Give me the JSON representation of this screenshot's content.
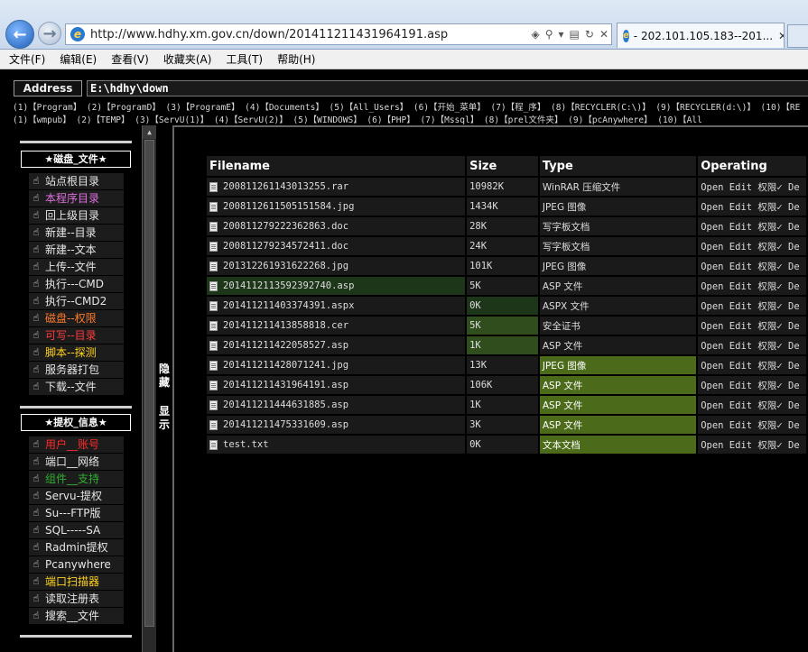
{
  "browser": {
    "url": "http://www.hdhy.xm.gov.cn/down/201411211431964191.asp",
    "tab_title": "- 202.101.105.183--201...",
    "menu": [
      "文件(F)",
      "编辑(E)",
      "查看(V)",
      "收藏夹(A)",
      "工具(T)",
      "帮助(H)"
    ]
  },
  "address": {
    "label": "Address",
    "path": "E:\\hdhy\\down"
  },
  "quick_links": {
    "row1": "(1)【Program】 (2)【ProgramD】 (3)【ProgramE】 (4)【Documents】 (5)【All_Users】 (6)【开始_菜单】 (7)【程_序】 (8)【RECYCLER(C:\\)】 (9)【RECYCLER(d:\\)】 (10)【RE",
    "row2": "(1)【wmpub】 (2)【TEMP】 (3)【ServU(1)】 (4)【ServU(2)】 (5)【WINDOWS】 (6)【PHP】 (7)【Mssql】 (8)【prel文件夹】 (9)【pcAnywhere】 (10)【All"
  },
  "sidebar": {
    "section1_title": "★磁盘_文件★",
    "section1_items": [
      {
        "label": "站点根目录",
        "color": "#e6e6e6"
      },
      {
        "label": "本程序目录",
        "color": "#e070e0"
      },
      {
        "label": "回上级目录",
        "color": "#e6e6e6"
      },
      {
        "label": "新建--目录",
        "color": "#e6e6e6"
      },
      {
        "label": "新建--文本",
        "color": "#e6e6e6"
      },
      {
        "label": "上传--文件",
        "color": "#e6e6e6"
      },
      {
        "label": "执行---CMD",
        "color": "#e6e6e6"
      },
      {
        "label": "执行--CMD2",
        "color": "#e6e6e6"
      },
      {
        "label": "磁盘--权限",
        "color": "#ff7a2a"
      },
      {
        "label": "可写--目录",
        "color": "#ff3c3c"
      },
      {
        "label": "脚本--探测",
        "color": "#ffd21e"
      },
      {
        "label": "服务器打包",
        "color": "#e6e6e6"
      },
      {
        "label": "下载--文件",
        "color": "#e6e6e6"
      }
    ],
    "section2_title": "★提权_信息★",
    "section2_items": [
      {
        "label": "用户__账号",
        "color": "#ff2a2a"
      },
      {
        "label": "端口__网络",
        "color": "#e6e6e6"
      },
      {
        "label": "组件__支持",
        "color": "#2fae2f"
      },
      {
        "label": "Servu-提权",
        "color": "#e6e6e6"
      },
      {
        "label": "Su---FTP版",
        "color": "#e6e6e6"
      },
      {
        "label": "SQL-----SA",
        "color": "#e6e6e6"
      },
      {
        "label": "Radmin提权",
        "color": "#e6e6e6"
      },
      {
        "label": "Pcanywhere",
        "color": "#e6e6e6"
      },
      {
        "label": "端口扫描器",
        "color": "#ffd21e"
      },
      {
        "label": "读取注册表",
        "color": "#e6e6e6"
      },
      {
        "label": "搜索__文件",
        "color": "#e6e6e6"
      }
    ]
  },
  "toggle": {
    "hide": "隐藏",
    "show": "显示"
  },
  "table": {
    "headers": {
      "name": "Filename",
      "size": "Size",
      "type": "Type",
      "ops": "Operating"
    },
    "ops_text": "Open Edit 权限✓ De",
    "rows": [
      {
        "name": "20081126114301325 5.rar",
        "size": "10982K",
        "type": "WinRAR 压缩文件",
        "hl": ""
      },
      {
        "name": "200811261150515158 4.jpg",
        "size": "1434K",
        "type": "JPEG 图像",
        "hl": ""
      },
      {
        "name": "200811279222362863.doc",
        "size": "28K",
        "type": "写字板文档",
        "hl": ""
      },
      {
        "name": "200811279234572411.doc",
        "size": "24K",
        "type": "写字板文档",
        "hl": ""
      },
      {
        "name": "20131226193162226 8.jpg",
        "size": "101K",
        "type": "JPEG 图像",
        "hl": ""
      },
      {
        "name": "201411211359239274 0.asp",
        "size": "5K",
        "type": "ASP 文件",
        "hl": "name"
      },
      {
        "name": "201411211403374391.aspx",
        "size": "0K",
        "type": "ASPX 文件",
        "hl": "size"
      },
      {
        "name": "201411211413858818.cer",
        "size": "5K",
        "type": "安全证书",
        "hl": "size2"
      },
      {
        "name": "201411211422058527.asp",
        "size": "1K",
        "type": "ASP 文件",
        "hl": "size3"
      },
      {
        "name": "201411211428071241.jpg",
        "size": "13K",
        "type": "JPEG 图像",
        "hl": "type"
      },
      {
        "name": "201411211431964191.asp",
        "size": "106K",
        "type": "ASP 文件",
        "hl": "type"
      },
      {
        "name": "201411211444631885.asp",
        "size": "1K",
        "type": "ASP 文件",
        "hl": "type"
      },
      {
        "name": "201411211475331609.asp",
        "size": "3K",
        "type": "ASP 文件",
        "hl": "type"
      },
      {
        "name": "test.txt",
        "size": "0K",
        "type": "文本文档",
        "hl": "type"
      }
    ]
  }
}
